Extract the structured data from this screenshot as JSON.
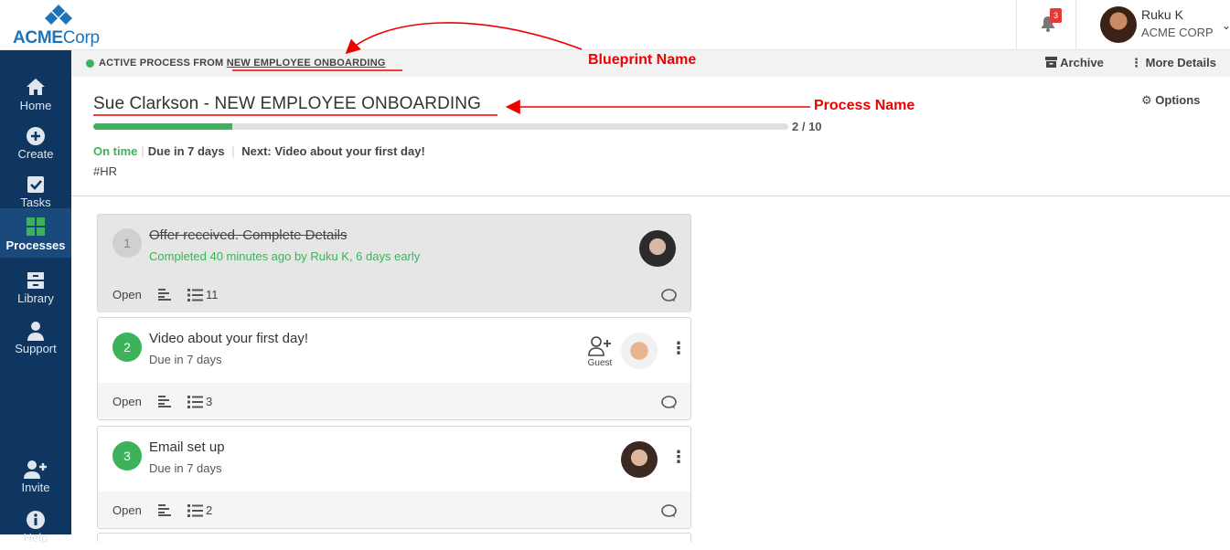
{
  "brand": {
    "name_main": "ACME",
    "name_rest": "Corp"
  },
  "notifications": {
    "count": "3"
  },
  "user": {
    "name": "Ruku K",
    "org": "ACME CORP"
  },
  "sidebar": {
    "items": [
      {
        "label": "Home",
        "icon": "home-icon"
      },
      {
        "label": "Create",
        "icon": "plus-circle-icon"
      },
      {
        "label": "Tasks",
        "icon": "check-square-icon"
      },
      {
        "label": "Processes",
        "icon": "grid-icon",
        "active": true
      },
      {
        "label": "Library",
        "icon": "archive-box-icon"
      },
      {
        "label": "Support",
        "icon": "person-icon"
      }
    ],
    "bottom": [
      {
        "label": "Invite",
        "icon": "user-plus-icon"
      },
      {
        "label": "Help",
        "icon": "info-icon"
      }
    ]
  },
  "strip": {
    "prefix": "ACTIVE PROCESS FROM",
    "blueprint": "NEW EMPLOYEE ONBOARDING",
    "archive": "Archive",
    "more": "More Details"
  },
  "process": {
    "title": "Sue Clarkson - NEW EMPLOYEE ONBOARDING",
    "progress_done": 2,
    "progress_total": 10,
    "progress_text": "2 / 10",
    "status": "On time",
    "due": "Due in 7 days",
    "next": "Next: Video about your first day!",
    "tag": "#HR",
    "options": "Options"
  },
  "tasks": [
    {
      "num": "1",
      "title": "Offer received. Complete Details",
      "sub": "Completed 40 minutes ago by Ruku K, 6 days early",
      "open": "Open",
      "checklist": "11",
      "done": true
    },
    {
      "num": "2",
      "title": "Video about your first day!",
      "sub": "Due in 7 days",
      "open": "Open",
      "checklist": "3",
      "guest": "Guest"
    },
    {
      "num": "3",
      "title": "Email set up",
      "sub": "Due in 7 days",
      "open": "Open",
      "checklist": "2"
    }
  ],
  "annotations": {
    "blueprint": "Blueprint Name",
    "process": "Process Name"
  },
  "colors": {
    "sidebar": "#0f3660",
    "accent_green": "#3cb25a",
    "annotation_red": "#e00000",
    "brand_blue": "#1f73b7"
  }
}
